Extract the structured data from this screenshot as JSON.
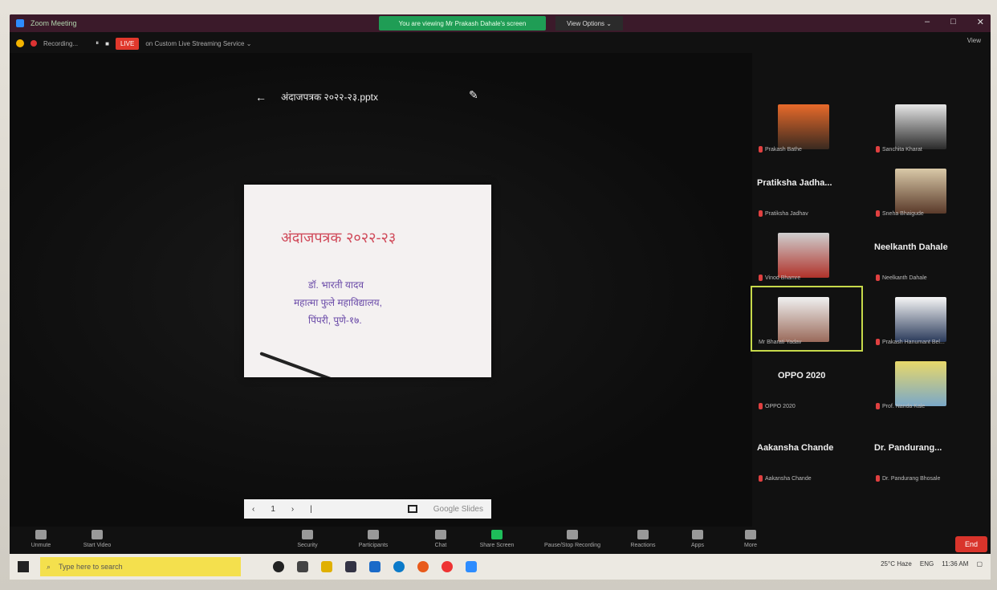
{
  "window": {
    "title": "Zoom Meeting",
    "share_banner": "You are viewing Mr Prakash Dahale's screen",
    "view_options": "View Options ⌄",
    "view_btn": "View",
    "min": "–",
    "max": "□",
    "close": "✕"
  },
  "recording": {
    "status": "Recording...",
    "pause": "⏸",
    "stop": "■",
    "live": "LIVE",
    "live_label": "on Custom Live Streaming Service ⌄"
  },
  "presentation": {
    "back": "←",
    "file_name": "अंदाजपत्रक २०२२-२३.pptx",
    "edit": "✎",
    "slide_title": "अंदाजपत्रक २०२२-२३",
    "line1": "डॉ. भारती यादव",
    "line2": "महात्मा फुले महाविद्यालय,",
    "line3": "पिंपरी, पुणे-१७.",
    "nav_prev": "‹",
    "nav_page": "1",
    "nav_next": "›",
    "nav_sep": "|",
    "nav_view": "Google Slides"
  },
  "participants": [
    {
      "label": "Prakash Bathe",
      "big": ""
    },
    {
      "label": "Sanchita Kharat",
      "big": ""
    },
    {
      "label": "Pratiksha Jadhav",
      "big": "Pratiksha Jadha..."
    },
    {
      "label": "Vinod Bhamre",
      "big": ""
    },
    {
      "label": "Sneha Bhaigude",
      "big": ""
    },
    {
      "label": "Neelkanth Dahale",
      "big": "Neelkanth Dahale"
    },
    {
      "label": "Mr Bharati Yadav",
      "big": ""
    },
    {
      "label": "Prakash Hanumant Bel...",
      "big": ""
    },
    {
      "label": "OPPO 2020",
      "big": "OPPO 2020"
    },
    {
      "label": "Prof. Nanda Kale",
      "big": ""
    },
    {
      "label": "Aakansha Chande",
      "big": "Aakansha Chande"
    },
    {
      "label": "Dr. Pandurang Bhosale",
      "big": "Dr. Pandurang..."
    }
  ],
  "toolbar": {
    "unmute": "Unmute",
    "start_video": "Start Video",
    "security": "Security",
    "participants": "Participants",
    "chat": "Chat",
    "share_screen": "Share Screen",
    "pause_recording": "Pause/Stop Recording",
    "reactions": "Reactions",
    "apps": "Apps",
    "more": "More",
    "end": "End"
  },
  "taskbar": {
    "search": "Type here to search",
    "weather": "25°C Haze",
    "lang": "ENG",
    "time": "11:36 AM"
  },
  "colors": {
    "share_banner": "#1f9d55",
    "slide_title": "#d04a5a",
    "slide_body": "#6a4aa8",
    "active_speaker": "#c7d94a",
    "end": "#d9342b",
    "search_box": "#f4e04d"
  }
}
